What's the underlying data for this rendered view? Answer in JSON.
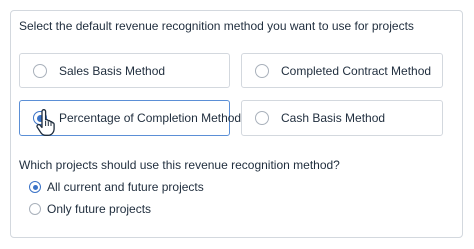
{
  "heading": "Select the default revenue recognition method you want to use for projects",
  "methods": [
    {
      "label": "Sales Basis Method",
      "selected": false
    },
    {
      "label": "Completed Contract Method",
      "selected": false
    },
    {
      "label": "Percentage of Completion Method",
      "selected": true
    },
    {
      "label": "Cash Basis Method",
      "selected": false
    }
  ],
  "question": "Which projects should use this revenue recognition method?",
  "scope_options": [
    {
      "label": "All current and future projects",
      "selected": true
    },
    {
      "label": "Only future projects",
      "selected": false
    }
  ],
  "colors": {
    "accent": "#3b73c7",
    "selected_border": "#5b8fd6",
    "border": "#d3d8de",
    "text": "#1f2d3d"
  },
  "icons": {
    "cursor": "hand-pointer-icon"
  }
}
